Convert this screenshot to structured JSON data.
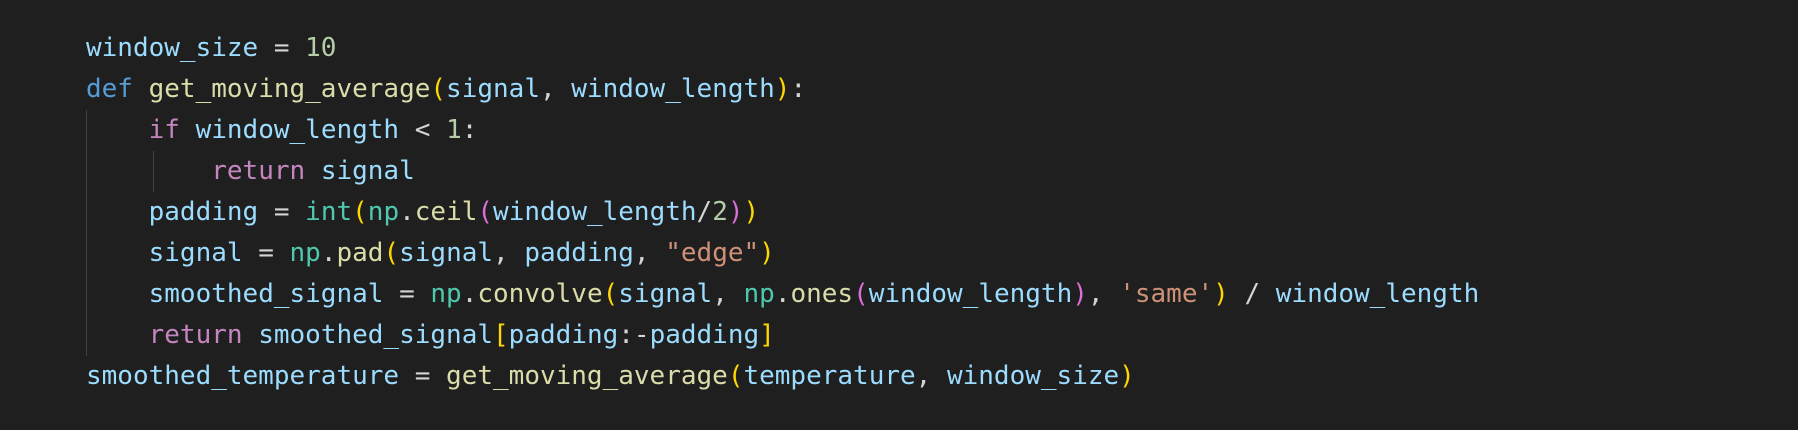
{
  "colors": {
    "background": "#1f1f1f",
    "variable": "#9cdcfe",
    "keyword": "#569cd6",
    "control": "#c586c0",
    "function": "#dcdcaa",
    "number": "#b5cea8",
    "string": "#ce9178",
    "operator": "#d4d4d4",
    "module": "#4ec9b0",
    "bracket_level_1": "#ffd700",
    "bracket_level_2": "#da70d6",
    "indent_guide": "#404040"
  },
  "code_lines": [
    {
      "tokens": [
        {
          "t": "window_size",
          "c": "t-var"
        },
        {
          "t": " = ",
          "c": "t-op"
        },
        {
          "t": "10",
          "c": "t-num"
        }
      ]
    },
    {
      "tokens": [
        {
          "t": "def",
          "c": "t-kw"
        },
        {
          "t": " ",
          "c": "t-op"
        },
        {
          "t": "get_moving_average",
          "c": "t-fn"
        },
        {
          "t": "(",
          "c": "t-b1"
        },
        {
          "t": "signal",
          "c": "t-var"
        },
        {
          "t": ", ",
          "c": "t-op"
        },
        {
          "t": "window_length",
          "c": "t-var"
        },
        {
          "t": ")",
          "c": "t-b1"
        },
        {
          "t": ":",
          "c": "t-op"
        }
      ]
    },
    {
      "tokens": [
        {
          "t": "    ",
          "c": "t-op"
        },
        {
          "t": "if",
          "c": "t-ctrl"
        },
        {
          "t": " ",
          "c": "t-op"
        },
        {
          "t": "window_length",
          "c": "t-var"
        },
        {
          "t": " < ",
          "c": "t-op"
        },
        {
          "t": "1",
          "c": "t-num"
        },
        {
          "t": ":",
          "c": "t-op"
        }
      ]
    },
    {
      "tokens": [
        {
          "t": "        ",
          "c": "t-op"
        },
        {
          "t": "return",
          "c": "t-ctrl"
        },
        {
          "t": " ",
          "c": "t-op"
        },
        {
          "t": "signal",
          "c": "t-var"
        }
      ]
    },
    {
      "tokens": [
        {
          "t": "    ",
          "c": "t-op"
        },
        {
          "t": "padding",
          "c": "t-var"
        },
        {
          "t": " = ",
          "c": "t-op"
        },
        {
          "t": "int",
          "c": "t-mod"
        },
        {
          "t": "(",
          "c": "t-b1"
        },
        {
          "t": "np",
          "c": "t-mod"
        },
        {
          "t": ".",
          "c": "t-op"
        },
        {
          "t": "ceil",
          "c": "t-fn"
        },
        {
          "t": "(",
          "c": "t-b2"
        },
        {
          "t": "window_length",
          "c": "t-var"
        },
        {
          "t": "/",
          "c": "t-op"
        },
        {
          "t": "2",
          "c": "t-num"
        },
        {
          "t": ")",
          "c": "t-b2"
        },
        {
          "t": ")",
          "c": "t-b1"
        }
      ]
    },
    {
      "tokens": [
        {
          "t": "    ",
          "c": "t-op"
        },
        {
          "t": "signal",
          "c": "t-var"
        },
        {
          "t": " = ",
          "c": "t-op"
        },
        {
          "t": "np",
          "c": "t-mod"
        },
        {
          "t": ".",
          "c": "t-op"
        },
        {
          "t": "pad",
          "c": "t-fn"
        },
        {
          "t": "(",
          "c": "t-b1"
        },
        {
          "t": "signal",
          "c": "t-var"
        },
        {
          "t": ", ",
          "c": "t-op"
        },
        {
          "t": "padding",
          "c": "t-var"
        },
        {
          "t": ", ",
          "c": "t-op"
        },
        {
          "t": "\"edge\"",
          "c": "t-str"
        },
        {
          "t": ")",
          "c": "t-b1"
        }
      ]
    },
    {
      "tokens": [
        {
          "t": "    ",
          "c": "t-op"
        },
        {
          "t": "smoothed_signal",
          "c": "t-var"
        },
        {
          "t": " = ",
          "c": "t-op"
        },
        {
          "t": "np",
          "c": "t-mod"
        },
        {
          "t": ".",
          "c": "t-op"
        },
        {
          "t": "convolve",
          "c": "t-fn"
        },
        {
          "t": "(",
          "c": "t-b1"
        },
        {
          "t": "signal",
          "c": "t-var"
        },
        {
          "t": ", ",
          "c": "t-op"
        },
        {
          "t": "np",
          "c": "t-mod"
        },
        {
          "t": ".",
          "c": "t-op"
        },
        {
          "t": "ones",
          "c": "t-fn"
        },
        {
          "t": "(",
          "c": "t-b2"
        },
        {
          "t": "window_length",
          "c": "t-var"
        },
        {
          "t": ")",
          "c": "t-b2"
        },
        {
          "t": ", ",
          "c": "t-op"
        },
        {
          "t": "'same'",
          "c": "t-str"
        },
        {
          "t": ")",
          "c": "t-b1"
        },
        {
          "t": " / ",
          "c": "t-op"
        },
        {
          "t": "window_length",
          "c": "t-var"
        }
      ]
    },
    {
      "tokens": [
        {
          "t": "    ",
          "c": "t-op"
        },
        {
          "t": "return",
          "c": "t-ctrl"
        },
        {
          "t": " ",
          "c": "t-op"
        },
        {
          "t": "smoothed_signal",
          "c": "t-var"
        },
        {
          "t": "[",
          "c": "t-b1"
        },
        {
          "t": "padding",
          "c": "t-var"
        },
        {
          "t": ":-",
          "c": "t-op"
        },
        {
          "t": "padding",
          "c": "t-var"
        },
        {
          "t": "]",
          "c": "t-b1"
        }
      ]
    },
    {
      "tokens": [
        {
          "t": "smoothed_temperature",
          "c": "t-var"
        },
        {
          "t": " = ",
          "c": "t-op"
        },
        {
          "t": "get_moving_average",
          "c": "t-fn"
        },
        {
          "t": "(",
          "c": "t-b1"
        },
        {
          "t": "temperature",
          "c": "t-var"
        },
        {
          "t": ", ",
          "c": "t-op"
        },
        {
          "t": "window_size",
          "c": "t-var"
        },
        {
          "t": ")",
          "c": "t-b1"
        }
      ]
    }
  ]
}
